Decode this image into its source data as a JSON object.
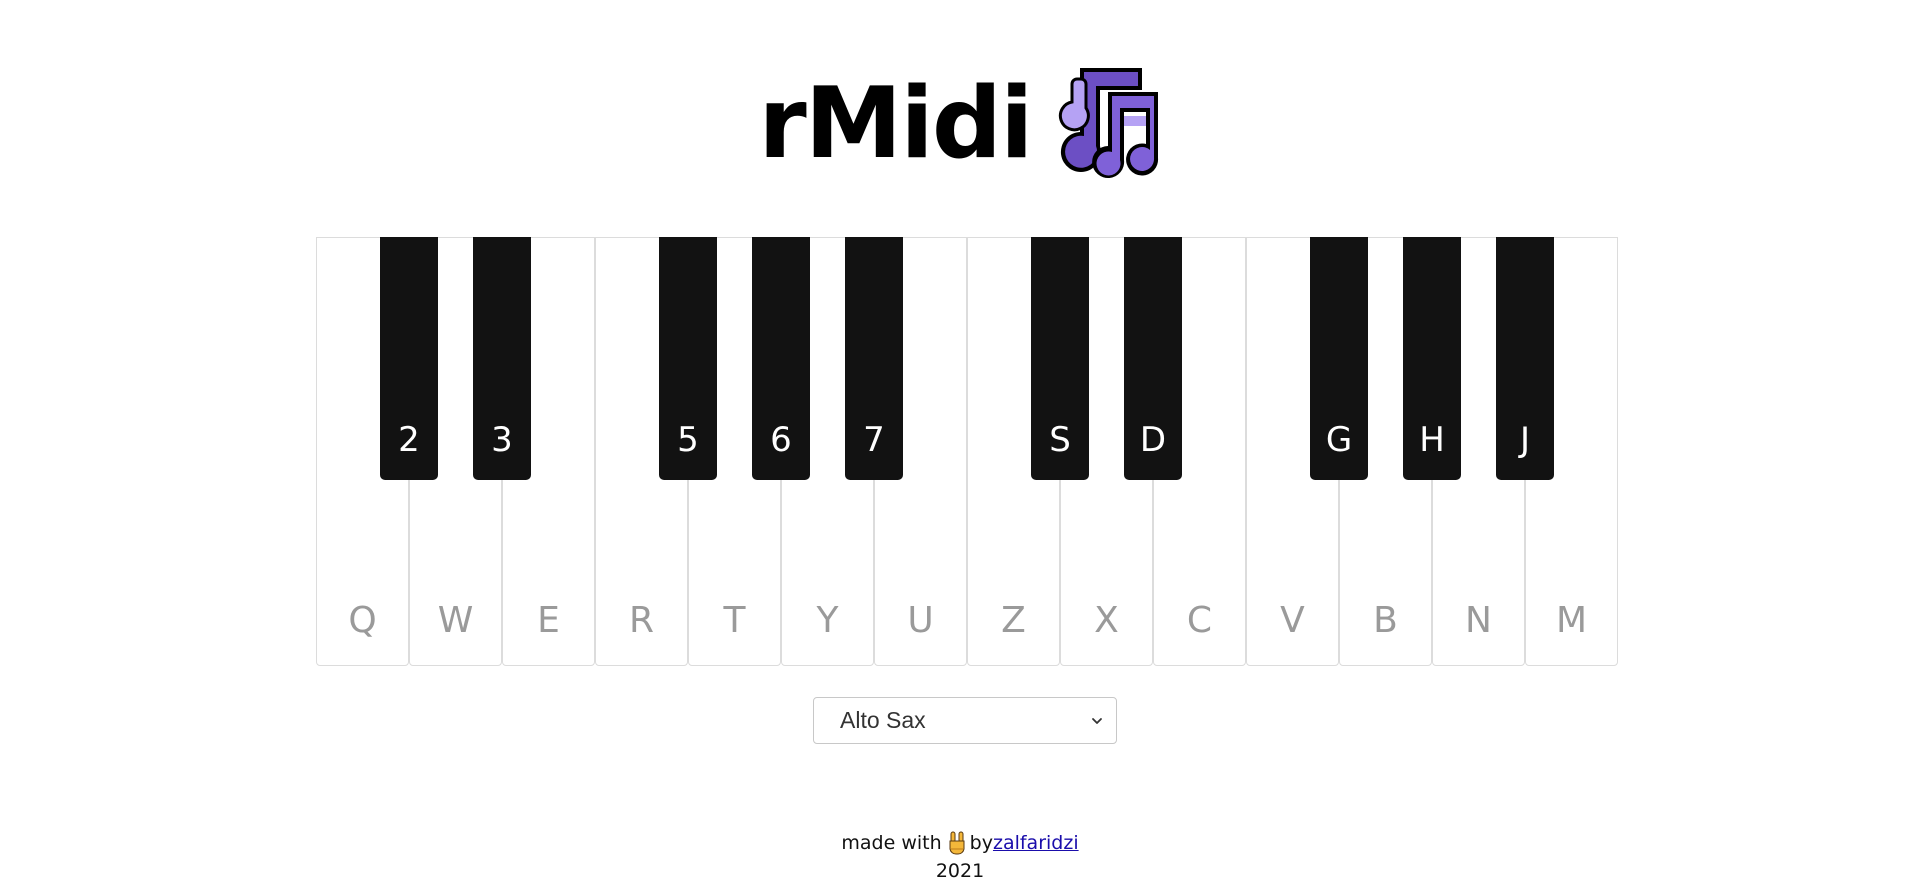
{
  "header": {
    "title": "rMidi",
    "logo_icon": "music-notes-icon"
  },
  "colors": {
    "logo_outline": "#000000",
    "logo_purple_dark": "#6c4fc4",
    "logo_purple_light": "#b5a2f4",
    "black_key": "#121212",
    "white_key_label": "#9a9a9a",
    "link": "#1a0dab"
  },
  "piano": {
    "white_keys": [
      {
        "label": "Q"
      },
      {
        "label": "W"
      },
      {
        "label": "E"
      },
      {
        "label": "R"
      },
      {
        "label": "T"
      },
      {
        "label": "Y"
      },
      {
        "label": "U"
      },
      {
        "label": "Z"
      },
      {
        "label": "X"
      },
      {
        "label": "C"
      },
      {
        "label": "V"
      },
      {
        "label": "B"
      },
      {
        "label": "N"
      },
      {
        "label": "M"
      }
    ],
    "black_keys": [
      {
        "label": "2"
      },
      {
        "label": "3"
      },
      {
        "label": "5"
      },
      {
        "label": "6"
      },
      {
        "label": "7"
      },
      {
        "label": "S"
      },
      {
        "label": "D"
      },
      {
        "label": "G"
      },
      {
        "label": "H"
      },
      {
        "label": "J"
      }
    ]
  },
  "instrument": {
    "selected": "Alto Sax",
    "icon": "chevron-down-icon"
  },
  "footer": {
    "made_with": "made with",
    "icon": "rock-hand-icon",
    "by": "by",
    "author": "zalfaridzi",
    "year": "2021"
  }
}
